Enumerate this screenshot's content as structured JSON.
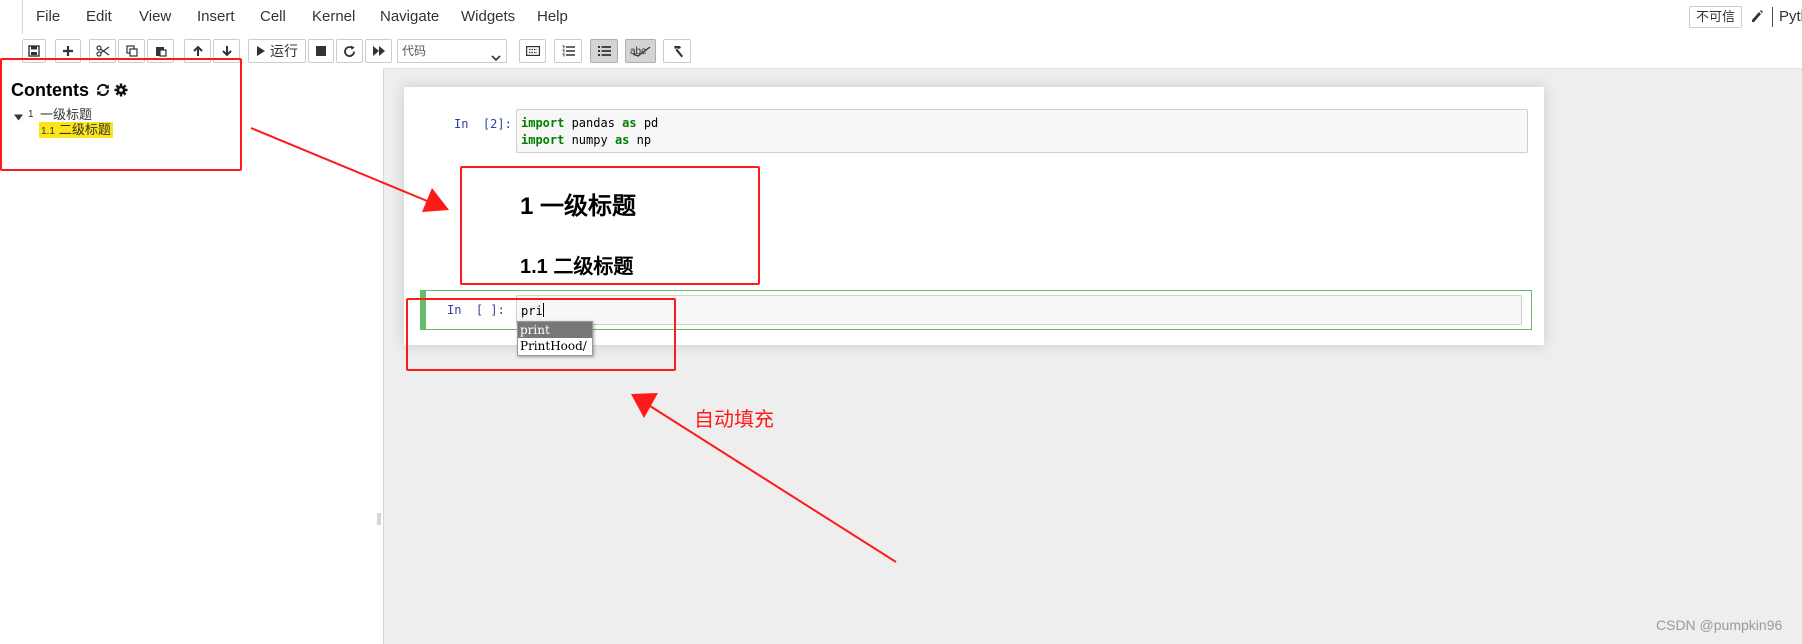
{
  "menubar": {
    "items": [
      "File",
      "Edit",
      "View",
      "Insert",
      "Cell",
      "Kernel",
      "Navigate",
      "Widgets",
      "Help"
    ],
    "trust_label": "不可信",
    "kernel_name": "Pyth"
  },
  "toolbar": {
    "run_label": "运行",
    "cell_type": "代码"
  },
  "toc": {
    "title": "Contents",
    "items": [
      {
        "num": "1",
        "label": "一级标题"
      },
      {
        "num": "1.1",
        "label": "二级标题"
      }
    ]
  },
  "cells": {
    "cell1": {
      "prompt": "In  [2]:",
      "lines": [
        {
          "kw1": "import",
          "mid": " pandas ",
          "kw2": "as",
          "rest": " pd"
        },
        {
          "kw1": "import",
          "mid": " numpy ",
          "kw2": "as",
          "rest": " np"
        }
      ]
    },
    "markdown": {
      "h1": "1  一级标题",
      "h2": "1.1  二级标题"
    },
    "cell3": {
      "prompt": "In  [ ]:",
      "input": "pri"
    }
  },
  "autocomplete": {
    "options": [
      "print",
      "PrintHood/"
    ]
  },
  "annotation": {
    "text": "自动填充"
  },
  "watermark": "CSDN @pumpkin96",
  "colors": {
    "annotation_red": "#ff1a1a",
    "toc_highlight": "#fbe51a",
    "active_cell_border": "#66bb6a",
    "prompt_blue": "#303f9f",
    "keyword_green": "#008000"
  }
}
